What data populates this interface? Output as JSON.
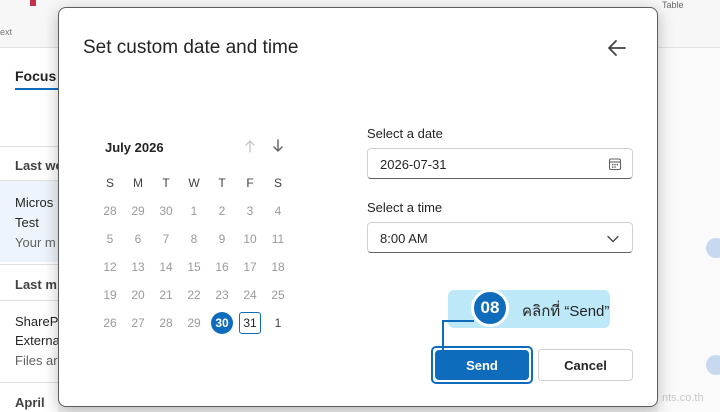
{
  "background": {
    "ribbon_text": "ext",
    "ribbon_right": "Table",
    "focus_tab": "Focus",
    "group_last_week": "Last we",
    "mail1_line1": "Micros",
    "mail1_line2": "Test",
    "mail1_line3": "Your m",
    "group_last_month": "Last m",
    "mail2_line1": "ShareP",
    "mail2_line2": "Externa",
    "mail2_line3": "Files ar",
    "group_april": "April",
    "watermark": "nts.co.th"
  },
  "dialog": {
    "title": "Set custom date and time",
    "calendar": {
      "month_label": "July 2026",
      "weekday_headers": [
        "S",
        "M",
        "T",
        "W",
        "T",
        "F",
        "S"
      ],
      "weeks": [
        [
          "28",
          "29",
          "30",
          "1",
          "2",
          "3",
          "4"
        ],
        [
          "5",
          "6",
          "7",
          "8",
          "9",
          "10",
          "11"
        ],
        [
          "12",
          "13",
          "14",
          "15",
          "16",
          "17",
          "18"
        ],
        [
          "19",
          "20",
          "21",
          "22",
          "23",
          "24",
          "25"
        ],
        [
          "26",
          "27",
          "28",
          "29",
          "30",
          "31",
          "1"
        ]
      ],
      "today": "30",
      "selected": "31"
    },
    "date_label": "Select a date",
    "date_value": "2026-07-31",
    "time_label": "Select a time",
    "time_value": "8:00 AM",
    "send_label": "Send",
    "cancel_label": "Cancel"
  },
  "annotation": {
    "step_number": "08",
    "text": "คลิกที่ “Send”"
  },
  "colors": {
    "accent": "#0f6cbd",
    "callout_bg": "#bde8f8"
  },
  "icons": [
    "back-arrow-icon",
    "arrow-up-icon",
    "arrow-down-icon",
    "calendar-icon",
    "chevron-down-icon"
  ]
}
